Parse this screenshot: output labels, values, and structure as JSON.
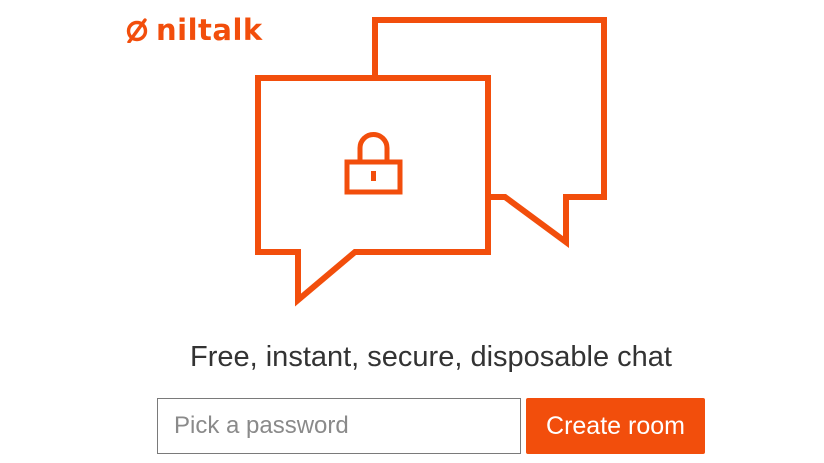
{
  "brand": {
    "name": "niltalk",
    "icon": "null-set-icon",
    "color": "#f24e0c"
  },
  "hero": {
    "illustration": "chat-bubbles-lock-icon"
  },
  "tagline": "Free, instant, secure, disposable chat",
  "form": {
    "password_value": "",
    "password_placeholder": "Pick a password",
    "submit_label": "Create room"
  },
  "colors": {
    "accent": "#f24e0c",
    "text": "#333333",
    "placeholder": "#8a8a8a",
    "input_border": "#7a7a7a",
    "background": "#ffffff"
  }
}
